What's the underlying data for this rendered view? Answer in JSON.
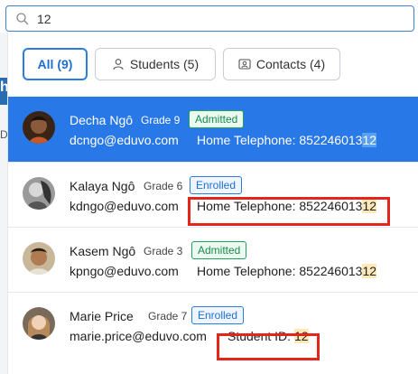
{
  "search": {
    "value": "12",
    "placeholder": ""
  },
  "backdrop": {
    "heading_char": "h",
    "side_char": "D"
  },
  "filters": [
    {
      "label": "All (9)",
      "icon": "",
      "active": true
    },
    {
      "label": "Students (5)",
      "icon": "person-icon",
      "active": false
    },
    {
      "label": "Contacts (4)",
      "icon": "contact-card-icon",
      "active": false
    }
  ],
  "results": [
    {
      "name": "Decha Ngô",
      "grade": "Grade 9",
      "status": "Admitted",
      "email": "dcngo@eduvo.com",
      "detail_label": "Home Telephone: ",
      "detail_prefix": "852246013",
      "detail_match": "12",
      "selected": true
    },
    {
      "name": "Kalaya Ngô",
      "grade": "Grade 6",
      "status": "Enrolled",
      "email": "kdngo@eduvo.com",
      "detail_label": "Home Telephone: ",
      "detail_prefix": "852246013",
      "detail_match": "12",
      "selected": false
    },
    {
      "name": "Kasem Ngô",
      "grade": "Grade 3",
      "status": "Admitted",
      "email": "kpngo@eduvo.com",
      "detail_label": "Home Telephone: ",
      "detail_prefix": "852246013",
      "detail_match": "12",
      "selected": false
    },
    {
      "name": "Marie Price",
      "grade": "Grade 7",
      "status": "Enrolled",
      "email": "marie.price@eduvo.com",
      "detail_label": "Student ID: ",
      "detail_prefix": "",
      "detail_match": "12",
      "selected": false
    }
  ],
  "colors": {
    "accent": "#2878e8",
    "admitted": "#22a05c",
    "enrolled": "#2b7de0",
    "highlight": "#fde9b8",
    "annotation": "#e3261b"
  }
}
